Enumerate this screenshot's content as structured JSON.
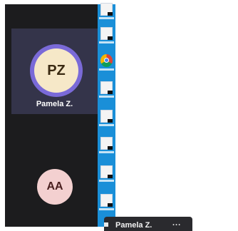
{
  "participants": [
    {
      "initials": "PZ",
      "name": "Pamela Z.",
      "active": true
    },
    {
      "initials": "AA",
      "name": "",
      "active": false
    }
  ],
  "tooltip": {
    "name": "Pamela Z.",
    "more": "..."
  },
  "colors": {
    "meeting_bg": "#1c1c1e",
    "active_tile": "#34344a",
    "active_ring": "#7a6ad8",
    "avatar_pz": "#f6e8c8",
    "avatar_aa": "#f3d0d0",
    "desktop": "#1a8fd8"
  },
  "desktop_icons": [
    "file-icon",
    "file-icon",
    "chrome-icon",
    "file-icon",
    "file-icon",
    "file-icon",
    "file-icon",
    "file-icon",
    "file-icon"
  ]
}
